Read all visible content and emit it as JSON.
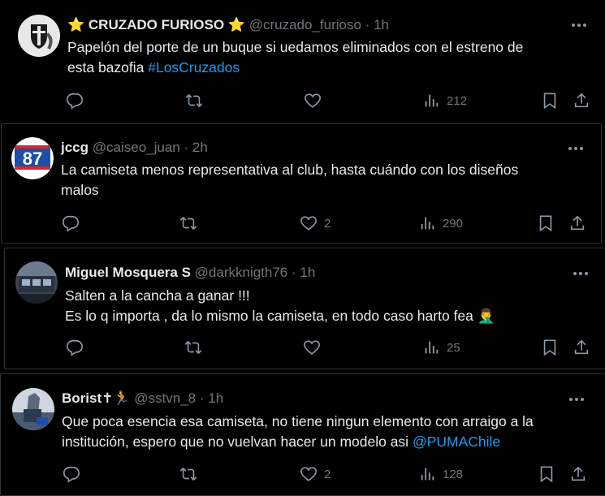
{
  "tweets": [
    {
      "name": "CRUZADO FURIOSO",
      "name_prefix": "⭐",
      "name_suffix": "⭐",
      "handle": "@cruzado_furioso",
      "sep": "·",
      "time": "1h",
      "text_line1": "Papelón del porte de un buque si uedamos eliminados con el estreno de",
      "text_line2": "esta bazofia ",
      "hashtag": "#LosCruzados",
      "replies": "",
      "retweets": "",
      "likes": "",
      "views": "212"
    },
    {
      "name": "jccg",
      "handle": "@caiseo_juan",
      "sep": "·",
      "time": "2h",
      "avatar_text": "87",
      "text_line1": "La camiseta menos representativa al club, hasta cuándo con los diseños",
      "text_line2": "malos",
      "likes": "2",
      "views": "290"
    },
    {
      "name": "Miguel Mosquera S",
      "handle": "@darkknigth76",
      "sep": "·",
      "time": "1h",
      "text_line1": "Salten a la cancha a ganar !!!",
      "text_line2": "Es lo q importa , da lo mismo la camiseta, en todo caso harto fea 🤦‍♂️",
      "likes": "",
      "views": "25"
    },
    {
      "name": "Borist✝🏃",
      "handle": "@sstvn_8",
      "sep": "·",
      "time": "1h",
      "text_line1": "Que poca esencia esa camiseta, no tiene ningun elemento con arraigo a la",
      "text_line2": "institución, espero que no vuelvan hacer un modelo asi ",
      "mention": "@PUMAChile",
      "likes": "2",
      "views": "128"
    }
  ],
  "icons": [
    "reply-icon",
    "retweet-icon",
    "like-icon",
    "views-icon",
    "bookmark-icon",
    "share-icon",
    "more-icon"
  ],
  "colors": {
    "background": "#000000",
    "text": "#e7e9ea",
    "muted": "#71767b",
    "link": "#1d9bf0",
    "border": "#2f3336"
  }
}
